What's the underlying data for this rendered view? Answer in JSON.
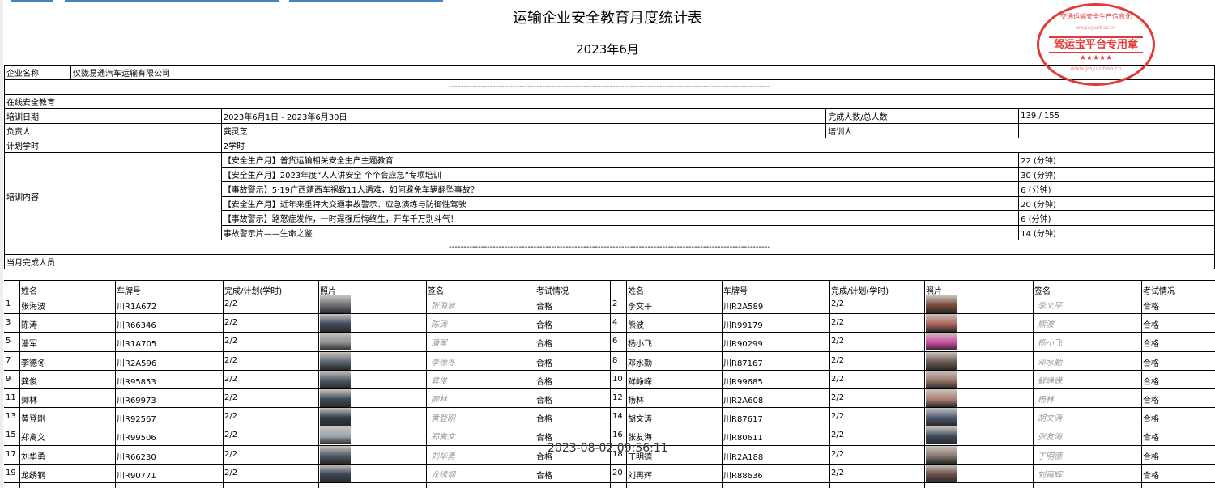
{
  "header": {
    "title": "运输企业安全教育月度统计表",
    "period": "2023年6月"
  },
  "stamp": {
    "main_text": "驾运宝平台专用章",
    "top_text": "交通运输安全生产信息化",
    "url_top": "ww.jiayunbao.cn",
    "url_bottom": "www.jiayunbao.cn",
    "stars": "★★★★★"
  },
  "company": {
    "label": "企业名称",
    "value": "仪陇易通汽车运输有限公司"
  },
  "separator": "--------------------------------------------------------------------------------------------------------------",
  "online": {
    "section_label": "在线安全教育",
    "date_label": "培训日期",
    "date_value": "2023年6月1日 - 2023年6月30日",
    "completion_label": "完成人数/总人数",
    "completion_value": "139 / 155",
    "lead_label": "负责人",
    "lead_value": "龚灵芝",
    "trainer_label": "培训人",
    "trainer_value": "",
    "hours_label": "计划学时",
    "hours_value": "2学时",
    "content_label": "培训内容",
    "courses": [
      {
        "title": "【安全生产月】普货运输相关安全生产主题教育",
        "duration": "22 (分钟)"
      },
      {
        "title": "【安全生产月】2023年度“人人讲安全 个个会应急”专项培训",
        "duration": "30 (分钟)"
      },
      {
        "title": "【事故警示】5·19广西靖西车祸致11人遇难，如何避免车辆翻坠事故？",
        "duration": "6 (分钟)"
      },
      {
        "title": "【安全生产月】近年来重特大交通事故警示、应急演练与防御性驾驶",
        "duration": "20 (分钟)"
      },
      {
        "title": "【事故警示】路怒症发作，一时逞强后悔终生，开车千万别斗气！",
        "duration": "6 (分钟)"
      },
      {
        "title": "事故警示片——生命之鉴",
        "duration": "14 (分钟)"
      }
    ]
  },
  "completed": {
    "section_label": "当月完成人员",
    "headers": [
      "姓名",
      "车牌号",
      "完成/计划(学时)",
      "照片",
      "签名",
      "考试情况"
    ],
    "left": [
      {
        "no": "1",
        "name": "张海波",
        "plate": "川R1A672",
        "progress": "2/2",
        "sig": "张海波",
        "exam": "合格"
      },
      {
        "no": "3",
        "name": "陈涛",
        "plate": "川R66346",
        "progress": "2/2",
        "sig": "陈涛",
        "exam": "合格"
      },
      {
        "no": "5",
        "name": "潘军",
        "plate": "川R1A705",
        "progress": "2/2",
        "sig": "潘军",
        "exam": "合格"
      },
      {
        "no": "7",
        "name": "李德冬",
        "plate": "川R2A596",
        "progress": "2/2",
        "sig": "李德冬",
        "exam": "合格"
      },
      {
        "no": "9",
        "name": "龚俊",
        "plate": "川R95853",
        "progress": "2/2",
        "sig": "龚俊",
        "exam": "合格"
      },
      {
        "no": "11",
        "name": "卿林",
        "plate": "川R69973",
        "progress": "2/2",
        "sig": "卿林",
        "exam": "合格"
      },
      {
        "no": "13",
        "name": "黄登刚",
        "plate": "川R92567",
        "progress": "2/2",
        "sig": "黄登刚",
        "exam": "合格"
      },
      {
        "no": "15",
        "name": "郑禽文",
        "plate": "川R99506",
        "progress": "2/2",
        "sig": "郑禽文",
        "exam": "合格"
      },
      {
        "no": "17",
        "name": "刘华勇",
        "plate": "川R66230",
        "progress": "2/2",
        "sig": "刘华勇",
        "exam": "合格"
      },
      {
        "no": "19",
        "name": "龙绣钢",
        "plate": "川R90771",
        "progress": "2/2",
        "sig": "龙绣钢",
        "exam": "合格"
      }
    ],
    "right": [
      {
        "no": "2",
        "name": "李文平",
        "plate": "川R2A589",
        "progress": "2/2",
        "sig": "李文平",
        "exam": "合格"
      },
      {
        "no": "4",
        "name": "熊波",
        "plate": "川R99179",
        "progress": "2/2",
        "sig": "熊波",
        "exam": "合格"
      },
      {
        "no": "6",
        "name": "杨小飞",
        "plate": "川R90299",
        "progress": "2/2",
        "sig": "杨小飞",
        "exam": "合格"
      },
      {
        "no": "8",
        "name": "邓水勤",
        "plate": "川R87167",
        "progress": "2/2",
        "sig": "邓水勤",
        "exam": "合格"
      },
      {
        "no": "10",
        "name": "鲜峥嵘",
        "plate": "川R99685",
        "progress": "2/2",
        "sig": "鲜峥嵘",
        "exam": "合格"
      },
      {
        "no": "12",
        "name": "杨林",
        "plate": "川R2A608",
        "progress": "2/2",
        "sig": "杨林",
        "exam": "合格"
      },
      {
        "no": "14",
        "name": "胡文涛",
        "plate": "川R87617",
        "progress": "2/2",
        "sig": "胡文涛",
        "exam": "合格"
      },
      {
        "no": "16",
        "name": "张友海",
        "plate": "川R80611",
        "progress": "2/2",
        "sig": "张友海",
        "exam": "合格"
      },
      {
        "no": "18",
        "name": "丁明德",
        "plate": "川R2A188",
        "progress": "2/2",
        "sig": "丁明德",
        "exam": "合格"
      },
      {
        "no": "20",
        "name": "刘再辉",
        "plate": "川R88636",
        "progress": "2/2",
        "sig": "刘再辉",
        "exam": "合格"
      }
    ]
  },
  "watermark": "2023-08-02 09:56:11",
  "colors": {
    "stamp": "#e23a3a",
    "tab": "#4a7fc1"
  }
}
